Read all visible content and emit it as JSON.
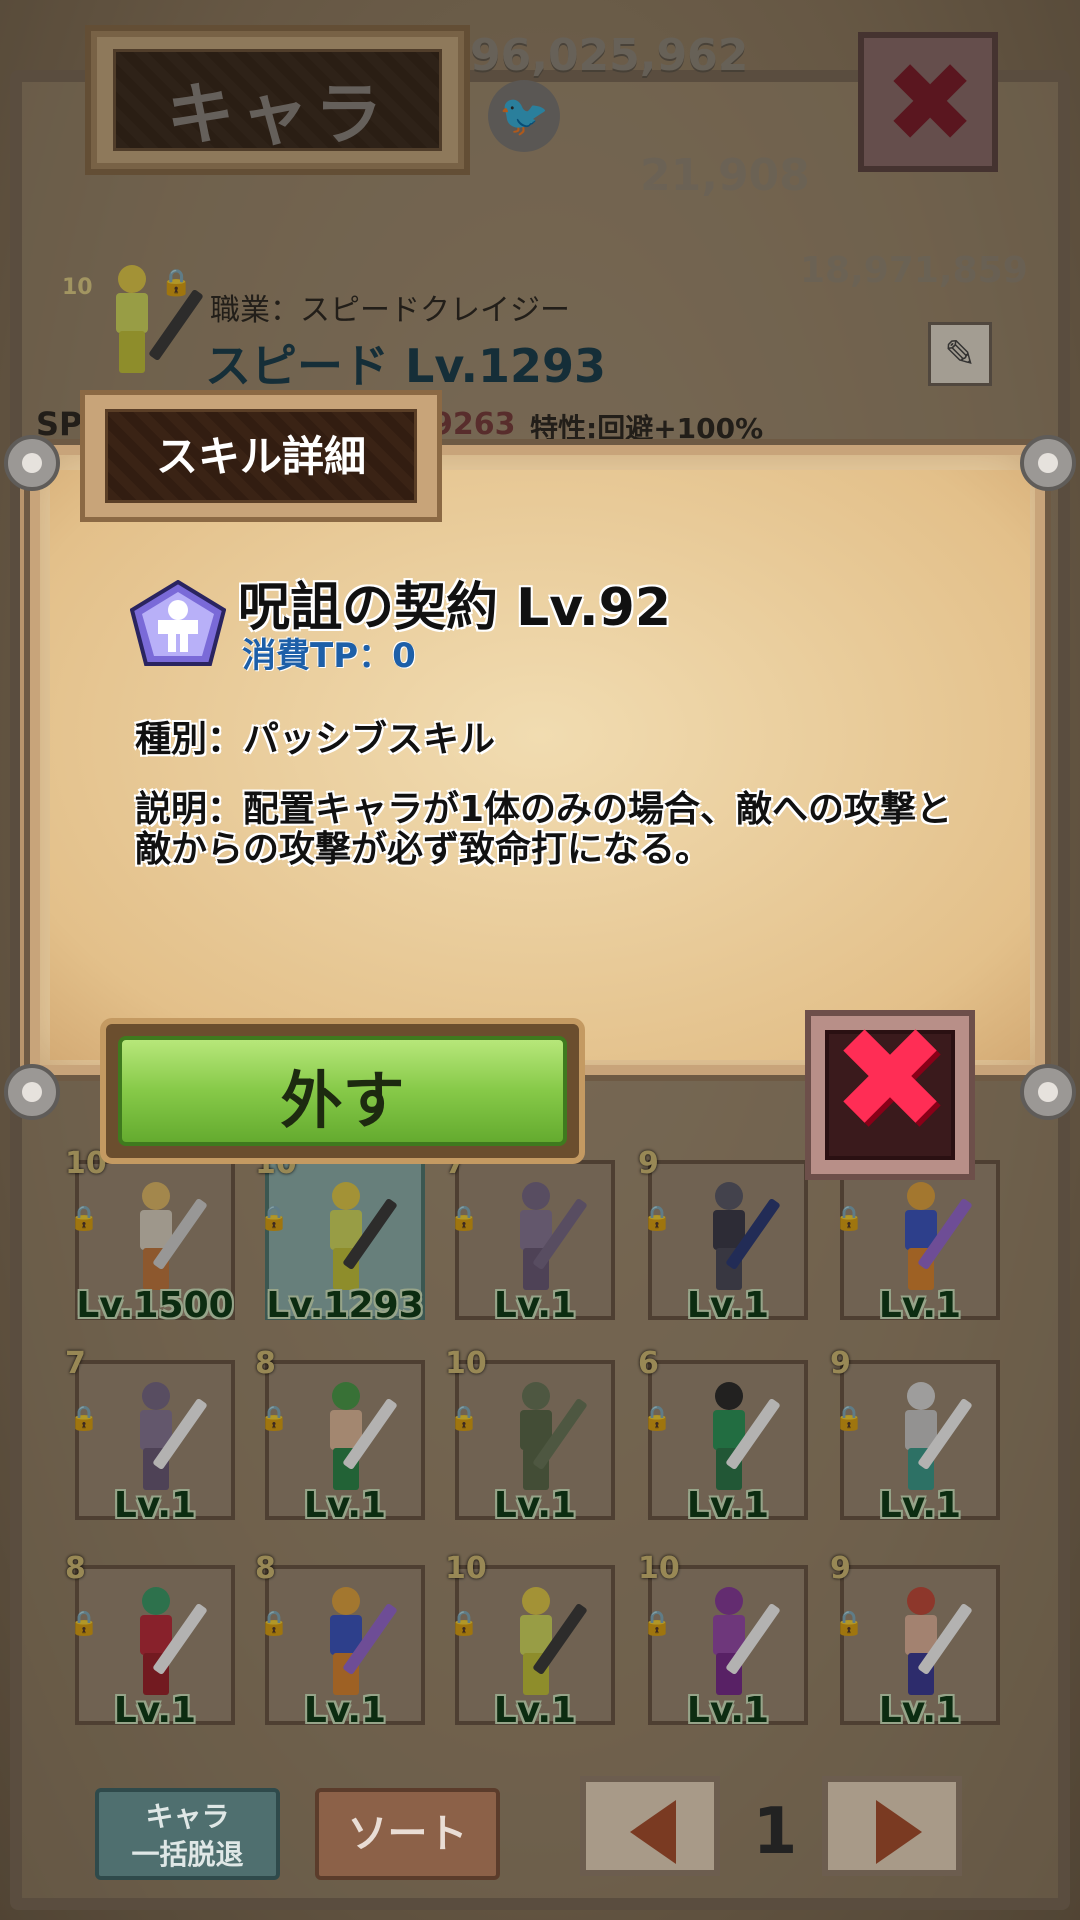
{
  "header": {
    "title": "キャラ",
    "money": "96,025,962",
    "bg_stat_1": "21,908",
    "bg_stat_2": "18,971,859"
  },
  "character": {
    "star": "10",
    "job": "職業：スピードクレイジー",
    "name": "スピード Lv.1293",
    "sp_label": "SP:",
    "sp_value": "9263",
    "trait": "特性:回避+100%"
  },
  "modal": {
    "tab_title": "スキル詳細",
    "skill_name": "呪詛の契約 Lv.92",
    "tp_cost": "消費TP：0",
    "skill_type": "種別：パッシブスキル",
    "description": "説明：配置キャラが1体のみの場合、敵への攻撃と敵からの攻撃が必ず致命打になる。",
    "remove_label": "外す"
  },
  "grid": [
    {
      "star": "10",
      "level": "Lv.1500",
      "head": "#e8c06a",
      "body": "#e0d8c8",
      "legs": "#c87b3e",
      "weapon": "#d8d8d8"
    },
    {
      "star": "10",
      "level": "Lv.1293",
      "head": "#e8d04a",
      "body": "#d8e060",
      "legs": "#c9c93a",
      "weapon": "#3a3a3a",
      "selected": true
    },
    {
      "star": "7",
      "level": "Lv.1",
      "head": "#7a6a8a",
      "body": "#8a7a9a",
      "legs": "#6a5a7a",
      "weapon": "#7a6a8a"
    },
    {
      "star": "9",
      "level": "Lv.1",
      "head": "#5a5a6a",
      "body": "#3a3a4a",
      "legs": "#4a4a5a",
      "weapon": "#2a3a7a"
    },
    {
      "star": "9",
      "level": "Lv.1",
      "head": "#e8a840",
      "body": "#3a56c8",
      "legs": "#e08830",
      "weapon": "#9a6ad8"
    },
    {
      "star": "7",
      "level": "Lv.1",
      "head": "#7a6a8a",
      "body": "#8a7a9a",
      "legs": "#6a5a7a",
      "weapon": "#ffffff"
    },
    {
      "star": "8",
      "level": "Lv.1",
      "head": "#4aa04a",
      "body": "#e8c0a0",
      "legs": "#2a8a4a",
      "weapon": "#ffffff"
    },
    {
      "star": "10",
      "level": "Lv.1",
      "head": "#6a7a5a",
      "body": "#5a6a4a",
      "legs": "#5a6a4a",
      "weapon": "#6a7a5a"
    },
    {
      "star": "6",
      "level": "Lv.1",
      "head": "#2a2a2a",
      "body": "#2a9a5a",
      "legs": "#2a7a4a",
      "weapon": "#ffffff"
    },
    {
      "star": "9",
      "level": "Lv.1",
      "head": "#e0e0e0",
      "body": "#d0d0d0",
      "legs": "#3aa090",
      "weapon": "#ffffff"
    },
    {
      "star": "8",
      "level": "Lv.1",
      "head": "#3aa06a",
      "body": "#c02a3a",
      "legs": "#a0202a",
      "weapon": "#ffffff"
    },
    {
      "star": "8",
      "level": "Lv.1",
      "head": "#e8a840",
      "body": "#3a56c8",
      "legs": "#e08830",
      "weapon": "#9a6ad8"
    },
    {
      "star": "10",
      "level": "Lv.1",
      "head": "#e8d04a",
      "body": "#d8e060",
      "legs": "#c9c93a",
      "weapon": "#3a3a3a"
    },
    {
      "star": "10",
      "level": "Lv.1",
      "head": "#8a3aa0",
      "body": "#9a4ab0",
      "legs": "#7a2a90",
      "weapon": "#ffffff"
    },
    {
      "star": "9",
      "level": "Lv.1",
      "head": "#c84a3a",
      "body": "#e8b8a0",
      "legs": "#3a3a9a",
      "weapon": "#ffffff"
    }
  ],
  "bottom": {
    "bulk_line1": "キャラ",
    "bulk_line2": "一括脱退",
    "sort_label": "ソート",
    "page": "1"
  },
  "colors": {
    "skill_tp": "#1d5fa8",
    "level_text": "#0a3a14",
    "close_x": "#ff2d55",
    "remove_button": "#86c948"
  }
}
